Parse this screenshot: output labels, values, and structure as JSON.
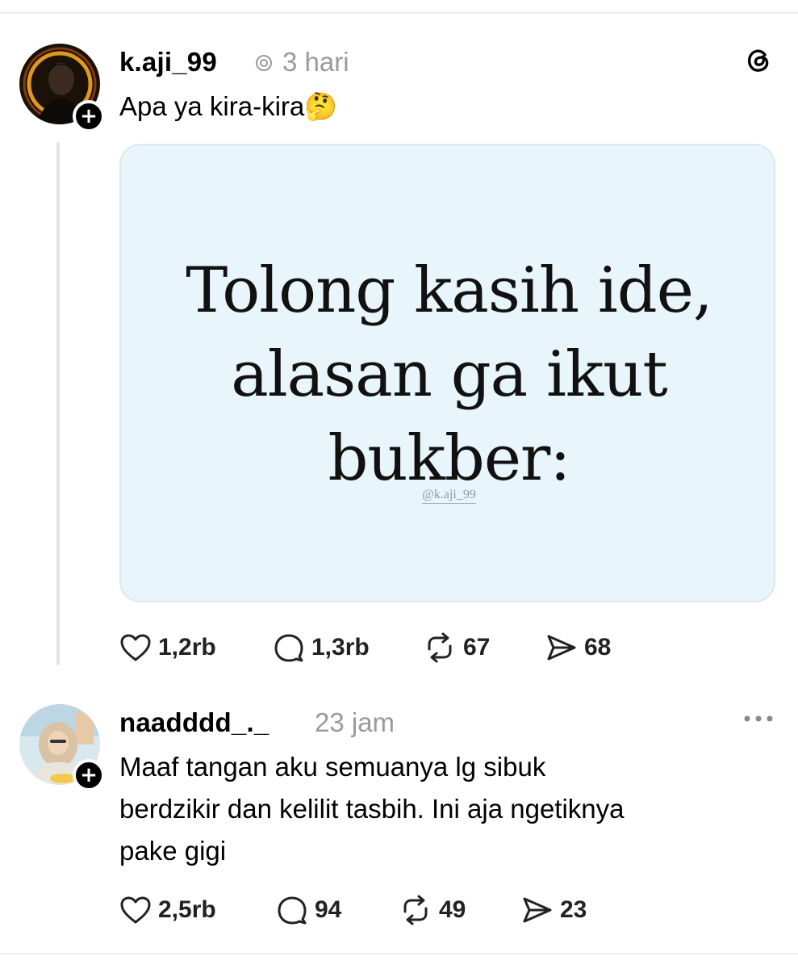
{
  "post": {
    "username": "k.aji_99",
    "time": "3 hari",
    "caption": "Apa ya kira-kira",
    "caption_emoji": "🤔",
    "media": {
      "lines": [
        "Tolong kasih ide,",
        "alasan ga ikut",
        "bukber:"
      ],
      "handle": "@k.aji_99"
    },
    "actions": {
      "likes": "1,2rb",
      "replies": "1,3rb",
      "reposts": "67",
      "shares": "68"
    }
  },
  "reply": {
    "username": "naadddd_._",
    "time": "23 jam",
    "text_lines": [
      "Maaf tangan aku semuanya lg sibuk",
      "berdzikir dan kelilit tasbih. Ini aja ngetiknya",
      "pake gigi"
    ],
    "actions": {
      "likes": "2,5rb",
      "replies": "94",
      "reposts": "49",
      "shares": "23"
    }
  },
  "icons": {
    "app_logo": "threads-icon",
    "more": "more-options-icon",
    "like": "heart-icon",
    "reply": "comment-icon",
    "repost": "repost-icon",
    "share": "send-icon",
    "follow": "plus-icon",
    "status": "threads-mini-icon"
  },
  "colors": {
    "media_background": "#e8f5fa",
    "meta_text": "#9a9a9a",
    "thread_line": "#e3e3e3"
  }
}
